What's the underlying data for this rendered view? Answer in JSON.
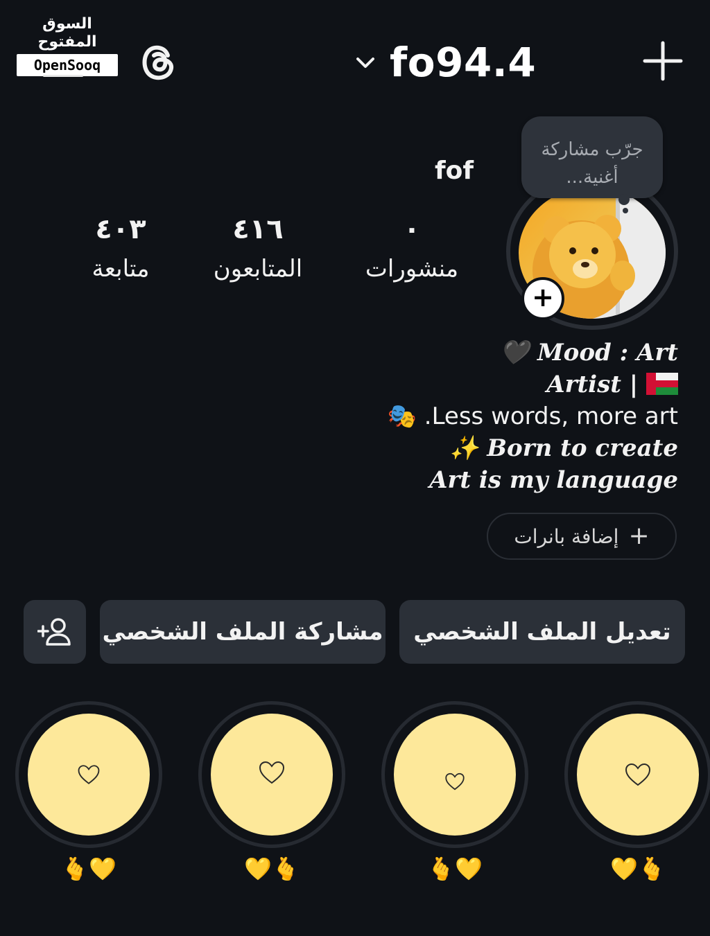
{
  "watermark": {
    "arabic": "السوق المفتوح",
    "english": "OpenSooq"
  },
  "header": {
    "username": "fo94.4"
  },
  "profile": {
    "display_name": "fof",
    "song_tip_line1": "جرّب مشاركة",
    "song_tip_line2": "أغنية...",
    "stats": [
      {
        "value": "٠",
        "label": "منشورات"
      },
      {
        "value": "٤١٦",
        "label": "المتابعون"
      },
      {
        "value": "٤٠٣",
        "label": "متابعة"
      }
    ]
  },
  "bio": {
    "line1_emoji": "🖤",
    "line1_text": "Mood : Art",
    "line2_text": "Artist |",
    "line3_text": ".Less words, more art",
    "line3_emoji": "🎭",
    "line4_emoji": "✨",
    "line4_text": "Born to create",
    "line5_text": "Art is my language"
  },
  "add_banners_label": "إضافة بانرات",
  "buttons": {
    "edit_profile": "تعديل الملف الشخصي",
    "share_profile": "مشاركة الملف الشخصي"
  },
  "highlights": [
    {
      "label": "💛🫰"
    },
    {
      "label": "🫰💛"
    },
    {
      "label": "💛🫰"
    },
    {
      "label": "🫰💛"
    }
  ],
  "colors": {
    "background": "#0f1217",
    "button": "#2b3038",
    "highlight_fill": "#fde89a"
  }
}
